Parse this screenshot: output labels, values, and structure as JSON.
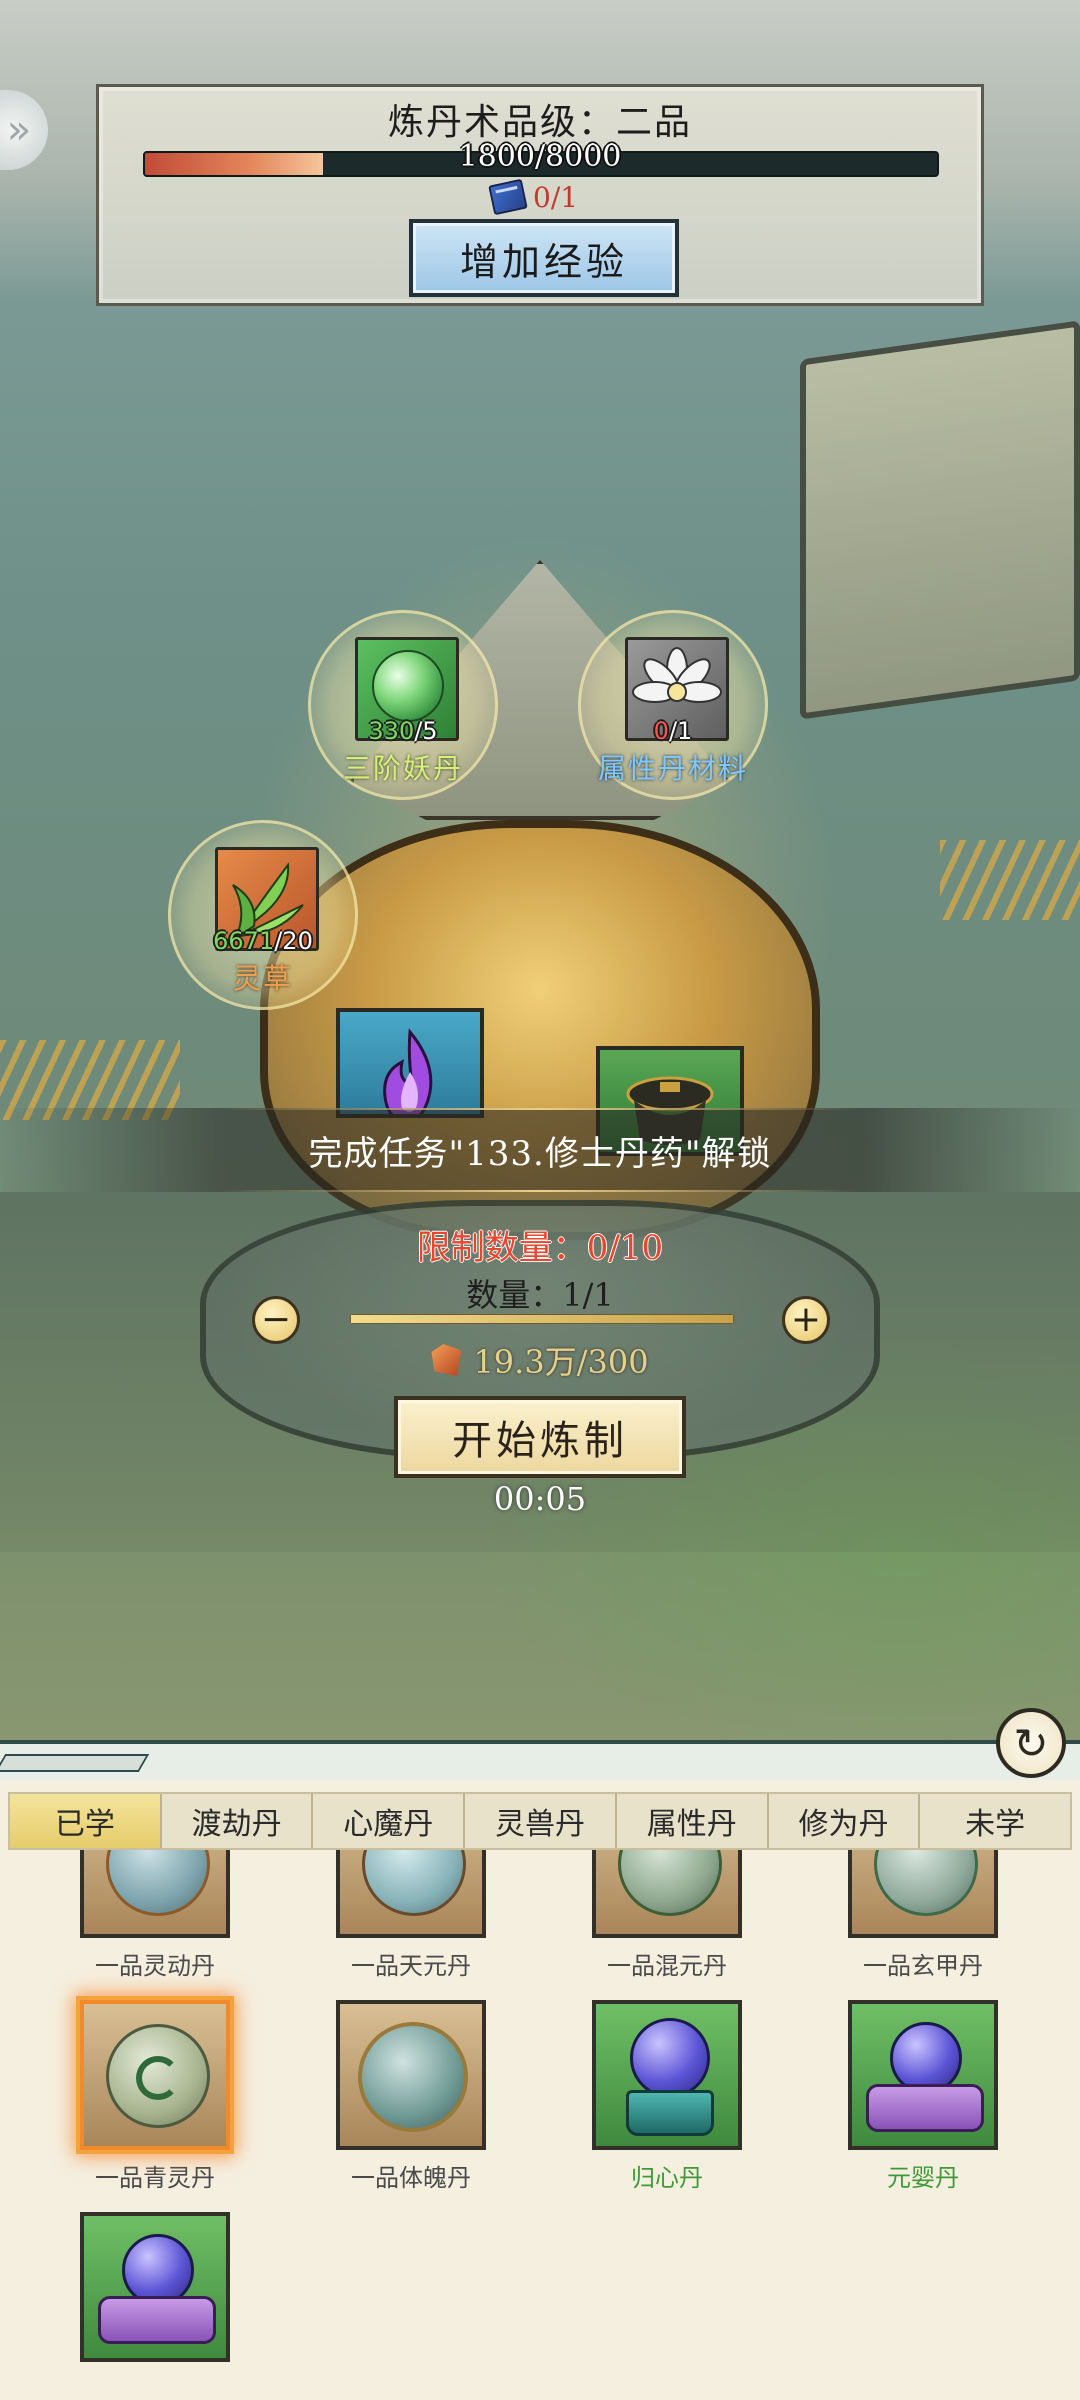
{
  "header": {
    "title": "炼丹术品级：二品",
    "exp_text": "1800/8000",
    "exp_fraction": 0.225,
    "book_count": "0/1",
    "add_exp_label": "增加经验"
  },
  "ingredients": [
    {
      "name": "三阶妖丹",
      "have": "330",
      "need": "/5",
      "icon": "green-orb-icon",
      "name_color": "#d8f07a"
    },
    {
      "name": "属性丹材料",
      "have": "0",
      "need": "/1",
      "icon": "white-lotus-icon",
      "name_color": "#7fc8ff"
    },
    {
      "name": "灵草",
      "have": "6671",
      "need": "/20",
      "icon": "herb-leaf-icon",
      "name_color": "#f0a04a"
    }
  ],
  "products": [
    {
      "icon": "purple-flame-icon"
    },
    {
      "icon": "cauldron-icon"
    }
  ],
  "craft": {
    "unlock_text": "完成任务\"133.修士丹药\"解锁",
    "limit_text": "限制数量：0/10",
    "qty_text": "数量：1/1",
    "qty_fraction": 1.0,
    "minus_label": "−",
    "plus_label": "+",
    "cost_text": "19.3万/300",
    "start_label": "开始炼制",
    "timer": "00:05"
  },
  "tabs": [
    {
      "label": "已学",
      "active": true
    },
    {
      "label": "渡劫丹",
      "active": false
    },
    {
      "label": "心魔丹",
      "active": false
    },
    {
      "label": "灵兽丹",
      "active": false
    },
    {
      "label": "属性丹",
      "active": false
    },
    {
      "label": "修为丹",
      "active": false
    },
    {
      "label": "未学",
      "active": false
    }
  ],
  "pills": [
    {
      "name": "一品灵动丹",
      "bg": "brown",
      "name_style": "grey"
    },
    {
      "name": "一品天元丹",
      "bg": "brown",
      "name_style": "grey"
    },
    {
      "name": "一品混元丹",
      "bg": "brown",
      "name_style": "grey"
    },
    {
      "name": "一品玄甲丹",
      "bg": "brown",
      "name_style": "grey"
    },
    {
      "name": "一品青灵丹",
      "bg": "brown",
      "name_style": "grey",
      "selected": true
    },
    {
      "name": "一品体魄丹",
      "bg": "brown",
      "name_style": "grey"
    },
    {
      "name": "归心丹",
      "bg": "green",
      "name_style": "green"
    },
    {
      "name": "元婴丹",
      "bg": "green",
      "name_style": "green"
    },
    {
      "name": "",
      "bg": "green",
      "name_style": "green"
    }
  ],
  "colors": {
    "limit_red": "#e9462d",
    "cost_gold": "#e6cf88",
    "tab_active": "#eed67a",
    "selected_glow": "#f6a23c"
  }
}
